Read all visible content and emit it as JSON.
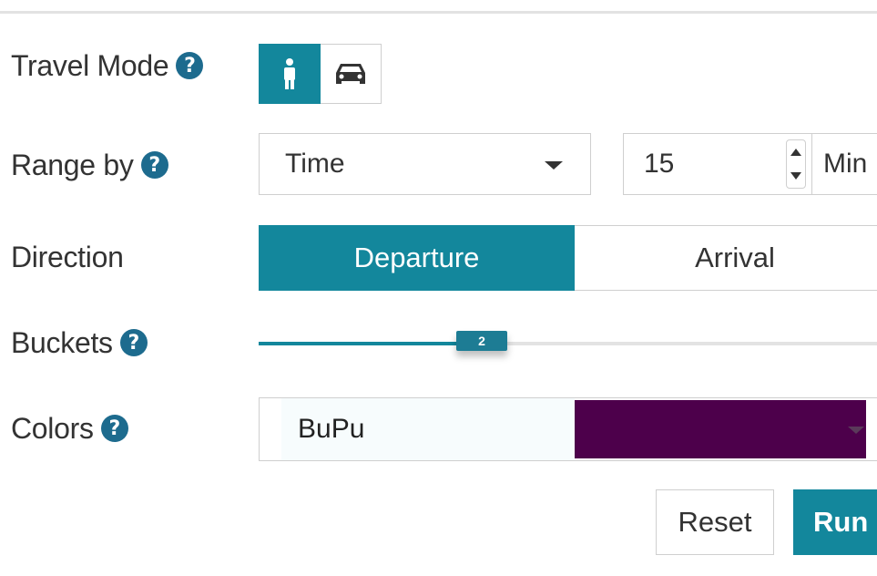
{
  "travel_mode": {
    "label": "Travel Mode",
    "help": "?",
    "options": [
      {
        "icon": "walking-person-icon",
        "active": true
      },
      {
        "icon": "car-icon",
        "active": false
      }
    ]
  },
  "range_by": {
    "label": "Range by",
    "help": "?",
    "selected": "Time",
    "value": "15",
    "unit": "Min"
  },
  "direction": {
    "label": "Direction",
    "options": [
      "Departure",
      "Arrival"
    ],
    "selected": "Departure"
  },
  "buckets": {
    "label": "Buckets",
    "help": "?",
    "value": "2",
    "fraction": 0.35
  },
  "colors": {
    "label": "Colors",
    "help": "?",
    "selected": "BuPu",
    "swatch_light": "#f7fcfd",
    "swatch_dark": "#4d004b"
  },
  "actions": {
    "reset": "Reset",
    "run": "Run"
  },
  "theme": {
    "accent": "#13879c",
    "help_icon": "#1d6b8e"
  }
}
